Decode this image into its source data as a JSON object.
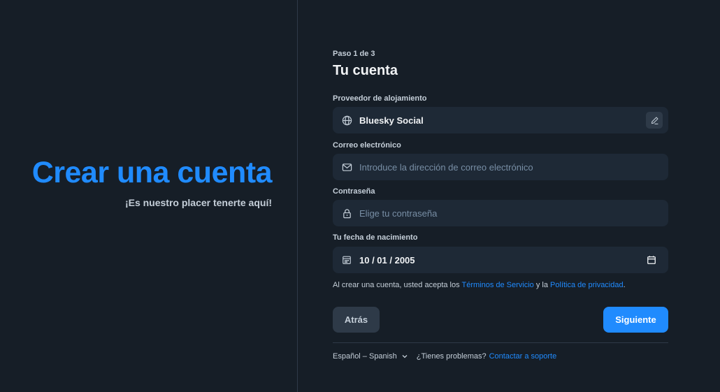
{
  "hero": {
    "title": "Crear una cuenta",
    "subtitle": "¡Es nuestro placer tenerte aquí!"
  },
  "form": {
    "step": "Paso 1 de 3",
    "title": "Tu cuenta",
    "provider": {
      "label": "Proveedor de alojamiento",
      "value": "Bluesky Social",
      "icon": "globe-icon",
      "edit_icon": "pencil-icon"
    },
    "email": {
      "label": "Correo electrónico",
      "placeholder": "Introduce la dirección de correo electrónico",
      "icon": "envelope-icon"
    },
    "password": {
      "label": "Contraseña",
      "placeholder": "Elige tu contraseña",
      "icon": "lock-icon"
    },
    "birthdate": {
      "label": "Tu fecha de nacimiento",
      "value": "10 / 01 / 2005",
      "icon": "calendar-icon"
    },
    "terms": {
      "prefix": "Al crear una cuenta, usted acepta los ",
      "tos_link": "Términos de Servicio",
      "middle": " y la ",
      "privacy_link": "Política de privacidad",
      "suffix": "."
    },
    "back_label": "Atrás",
    "next_label": "Siguiente"
  },
  "footer": {
    "language": "Español – Spanish",
    "help_text": "¿Tienes problemas?",
    "support_link": "Contactar a soporte"
  },
  "colors": {
    "background": "#161e27",
    "field": "#1e2936",
    "accent": "#208bfe",
    "muted_text": "#c5cfd9",
    "placeholder": "#788ea5"
  }
}
